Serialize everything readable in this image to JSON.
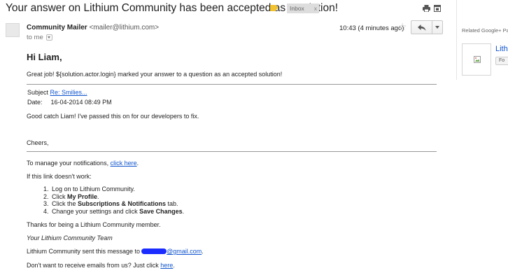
{
  "subject": "Your answer on Lithium Community has been accepted as a solution!",
  "label": "Inbox",
  "label_close": "x",
  "sender": {
    "name": "Community Mailer",
    "email": "<mailer@lithium.com>",
    "to": "to me",
    "time": "10:43 (4 minutes ago)",
    "star": "☆"
  },
  "body": {
    "greeting": "Hi Liam,",
    "intro": "Great job! ${solution.actor.login} marked your answer to a question as an accepted solution!",
    "subject_label": "Subject",
    "subject_link": "Re: Smilies...",
    "date_label": "Date:",
    "date_value": "16-04-2014 08:49 PM",
    "quote": "Good catch Liam! I've passed this on for our developers to fix.",
    "cheers": "Cheers,",
    "manage_prefix": "To manage your notifications, ",
    "manage_link": "click here",
    "manage_suffix": ".",
    "if_link": "If this link doesn't work:",
    "steps": [
      {
        "num": "1.",
        "pre": "Log on to Lithium Community.",
        "bold": "",
        "post": ""
      },
      {
        "num": "2.",
        "pre": "Click ",
        "bold": "My Profile",
        "post": "."
      },
      {
        "num": "3.",
        "pre": "Click the ",
        "bold": "Subscriptions & Notifications",
        "post": " tab."
      },
      {
        "num": "4.",
        "pre": "Change your settings and click ",
        "bold": "Save Changes",
        "post": "."
      }
    ],
    "thanks": "Thanks for being a Lithium Community member.",
    "team": "Your Lithium Community Team",
    "sent_prefix": "Lithium Community sent this message to",
    "sent_email_suffix": "@gmail.com",
    "sent_suffix": ".",
    "unsub_prefix": "Don't want to receive emails from us? Just click ",
    "unsub_link": "here",
    "unsub_suffix": "."
  },
  "sidebar": {
    "title": "Related Google+ Page",
    "page_name": "Lith",
    "follow_label": "Fo"
  },
  "colors": {
    "link": "#1155cc",
    "label_marker": "#f1c232",
    "redaction": "#1a2cff"
  }
}
